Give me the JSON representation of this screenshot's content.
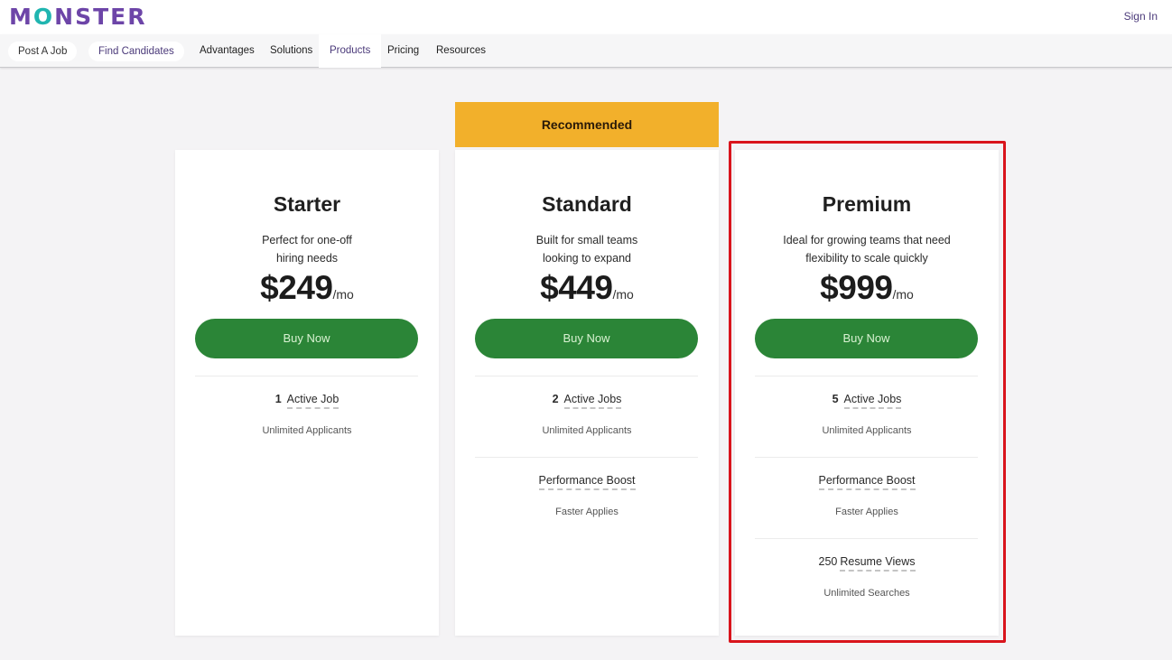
{
  "header": {
    "logo": {
      "prefix": "M",
      "o": "O",
      "suffix": "NSTER"
    },
    "sign_in": "Sign In"
  },
  "nav": {
    "pills": [
      "Post A Job",
      "Find Candidates"
    ],
    "links": [
      {
        "label": "Advantages",
        "active": false
      },
      {
        "label": "Solutions",
        "active": false
      },
      {
        "label": "Products",
        "active": true
      },
      {
        "label": "Pricing",
        "active": false
      },
      {
        "label": "Resources",
        "active": false
      }
    ]
  },
  "colors": {
    "brand_purple": "#6d45a8",
    "brand_teal": "#20b5b0",
    "buy_green": "#2b8537",
    "recommended_yellow": "#f2b02b",
    "highlight_red": "#d9141c"
  },
  "recommended_label": "Recommended",
  "plans": [
    {
      "name": "Starter",
      "desc_line1": "Perfect for one-off",
      "desc_line2": "hiring needs",
      "price": "$249",
      "per": "/mo",
      "buy": "Buy Now",
      "jobs_num": "1",
      "jobs_label": "Active Job",
      "jobs_sub": "Unlimited Applicants"
    },
    {
      "name": "Standard",
      "desc_line1": "Built for small teams",
      "desc_line2": "looking to expand",
      "price": "$449",
      "per": "/mo",
      "buy": "Buy Now",
      "jobs_num": "2",
      "jobs_label": "Active Jobs",
      "jobs_sub": "Unlimited Applicants",
      "boost_label": "Performance Boost",
      "boost_sub": "Faster Applies"
    },
    {
      "name": "Premium",
      "desc_line1": "Ideal for growing teams that need",
      "desc_line2": "flexibility to scale quickly",
      "price": "$999",
      "per": "/mo",
      "buy": "Buy Now",
      "jobs_num": "5",
      "jobs_label": "Active Jobs",
      "jobs_sub": "Unlimited Applicants",
      "boost_label": "Performance Boost",
      "boost_sub": "Faster Applies",
      "resume_num": "250",
      "resume_label": "Resume Views",
      "resume_sub": "Unlimited Searches"
    }
  ]
}
